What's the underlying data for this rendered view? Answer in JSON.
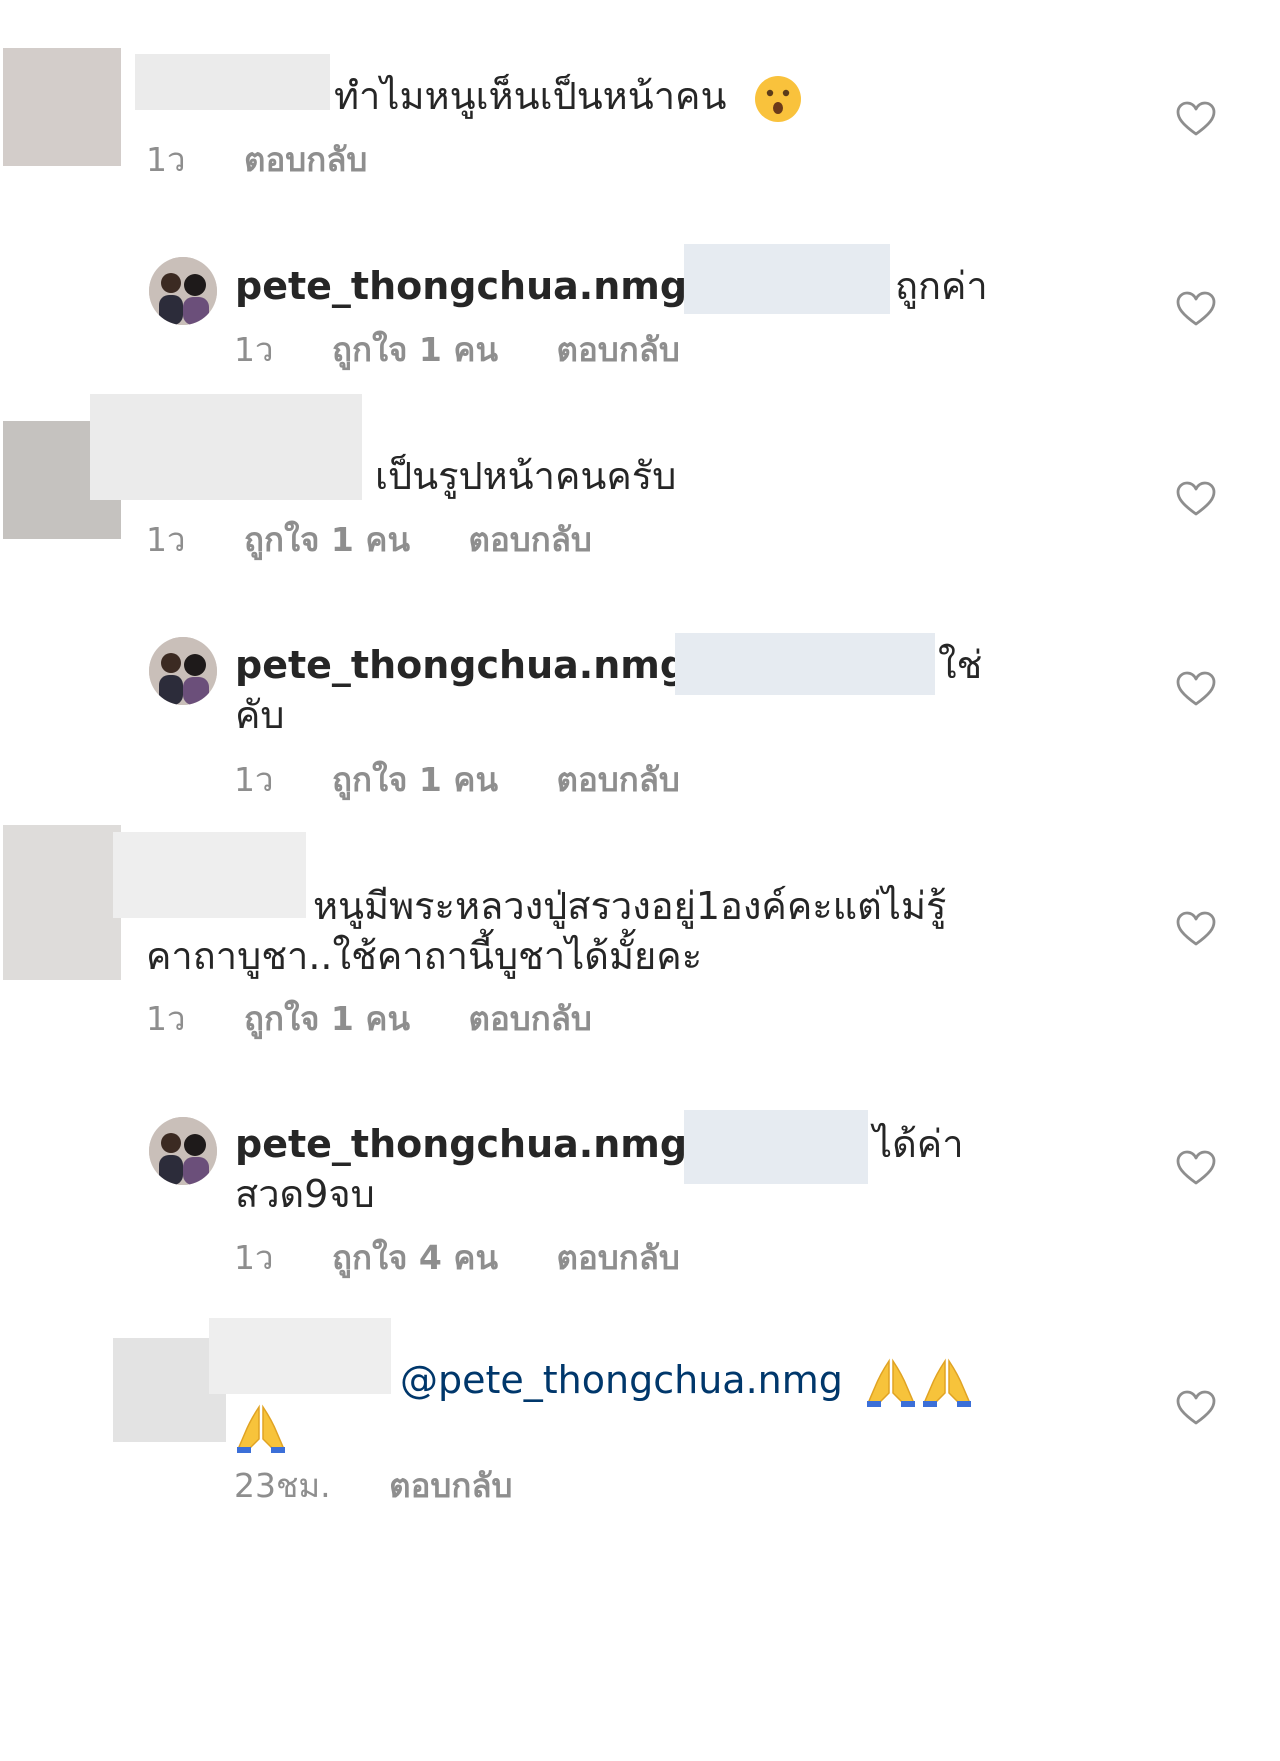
{
  "comments": [
    {
      "text": "ทำไมหนูเห็นเป็นหน้าคน",
      "time": "1ว",
      "reply": "ตอบกลับ"
    },
    {
      "username": "pete_thongchua.nmg",
      "text": "ถูกค่า",
      "time": "1ว",
      "likes": "ถูกใจ 1 คน",
      "reply": "ตอบกลับ"
    },
    {
      "text": "เป็นรูปหน้าคนครับ",
      "time": "1ว",
      "likes": "ถูกใจ 1 คน",
      "reply": "ตอบกลับ"
    },
    {
      "username": "pete_thongchua.nmg",
      "text_line1": "ใช่",
      "text_line2": "คับ",
      "time": "1ว",
      "likes": "ถูกใจ 1 คน",
      "reply": "ตอบกลับ"
    },
    {
      "text_line1": "หนูมีพระหลวงปู่สรวงอยู่1องค์คะแต่ไม่รู้",
      "text_line2": "คาถาบูชา..ใช้คาถานี้บูชาได้มั้ยคะ",
      "time": "1ว",
      "likes": "ถูกใจ 1 คน",
      "reply": "ตอบกลับ"
    },
    {
      "username": "pete_thongchua.nmg",
      "text_line1": "ได้ค่า",
      "text_line2": "สวด9จบ",
      "time": "1ว",
      "likes": "ถูกใจ 4 คน",
      "reply": "ตอบกลับ"
    },
    {
      "mention": "@pete_thongchua.nmg",
      "time": "23ชม.",
      "reply": "ตอบกลับ"
    }
  ],
  "icons": {
    "heart": "heart-outline-icon",
    "verified": "verified-badge-icon",
    "emoji_surprised": "hushed-face-emoji",
    "emoji_pray": "folded-hands-emoji"
  },
  "colors": {
    "text": "#262626",
    "meta": "#8e8e8e",
    "verified": "#3897f0",
    "mention": "#00376b"
  }
}
